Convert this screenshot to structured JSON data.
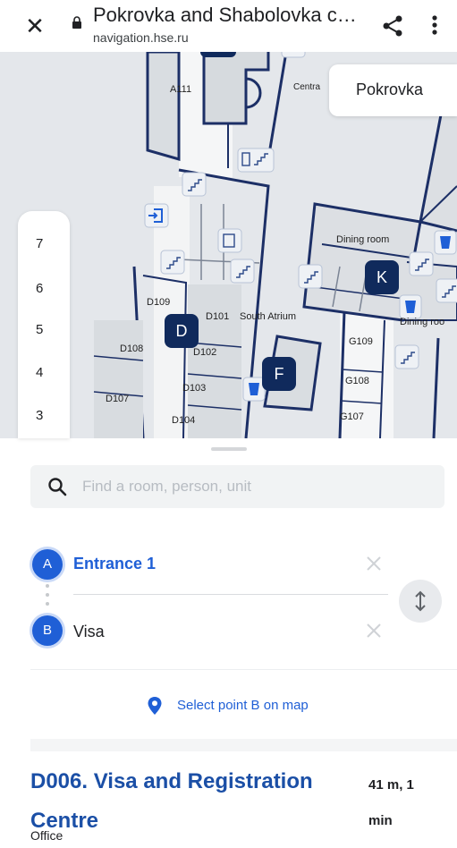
{
  "browser": {
    "page_title": "Pokrovka and Shabolovka c…",
    "url": "navigation.hse.ru",
    "close_icon": "close-icon",
    "lock_icon": "lock-icon",
    "share_icon": "share-icon",
    "more_icon": "more-vert-icon"
  },
  "map": {
    "campus": "Pokrovka",
    "floors": [
      "7",
      "6",
      "5",
      "4",
      "3"
    ],
    "buildings": [
      "D",
      "K",
      "F"
    ],
    "room_labels": {
      "a111": "A111",
      "central": "Centra",
      "dining1": "Dining room",
      "dining2": "Dining roo",
      "d109": "D109",
      "d101": "D101",
      "south_atrium": "South Atrium",
      "d108": "D108",
      "d102": "D102",
      "d107": "D107",
      "d103": "D103",
      "d104": "D104",
      "g109": "G109",
      "g108": "G108",
      "g107": "G107"
    }
  },
  "search": {
    "placeholder": "Find a room, person, unit",
    "value": ""
  },
  "route": {
    "point_a": {
      "badge": "A",
      "label": "Entrance 1"
    },
    "point_b": {
      "badge": "B",
      "label": "Visa"
    },
    "select_on_map": "Select point B on map"
  },
  "result": {
    "title": "D006. Visa and Registration Centre",
    "distance": "41 m, 1 min",
    "type": "Office"
  },
  "colors": {
    "accent": "#1f5fd6",
    "building_badge": "#102a5c",
    "result_title": "#1b4fa6",
    "map_wall": "#1c2f66"
  }
}
